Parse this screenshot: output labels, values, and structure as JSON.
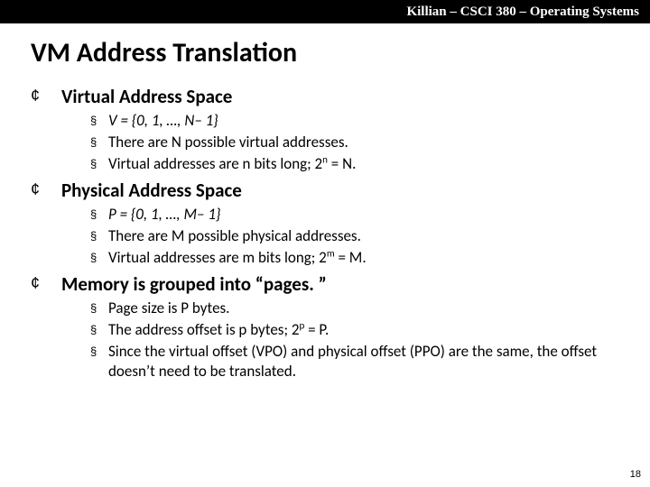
{
  "header": "Killian – CSCI 380 – Operating Systems",
  "title": "VM Address Translation",
  "sections": [
    {
      "heading": "Virtual Address Space",
      "items": [
        {
          "html": "<span class=\"italic\">V = {0, 1, …, N– 1}</span>"
        },
        {
          "html": "There are N possible virtual addresses."
        },
        {
          "html": "Virtual addresses are n bits long; 2<sup>n</sup> = N."
        }
      ]
    },
    {
      "heading": "Physical Address Space",
      "items": [
        {
          "html": "<span class=\"italic\">P = {0, 1, …, M– 1}</span>"
        },
        {
          "html": "There are M possible physical addresses."
        },
        {
          "html": "Virtual addresses are m bits long; 2<sup>m</sup> = M."
        }
      ]
    },
    {
      "heading": "Memory is grouped into “pages. ”",
      "items": [
        {
          "html": "Page size is P bytes."
        },
        {
          "html": "The address offset is p bytes; 2<sup>p</sup> = P."
        },
        {
          "html": "Since the virtual offset (VPO) and physical offset (PPO) are the same, the offset doesn’t need to be translated."
        }
      ]
    }
  ],
  "page_number": "18",
  "bullets": {
    "l1": "¢",
    "l2": "§"
  }
}
